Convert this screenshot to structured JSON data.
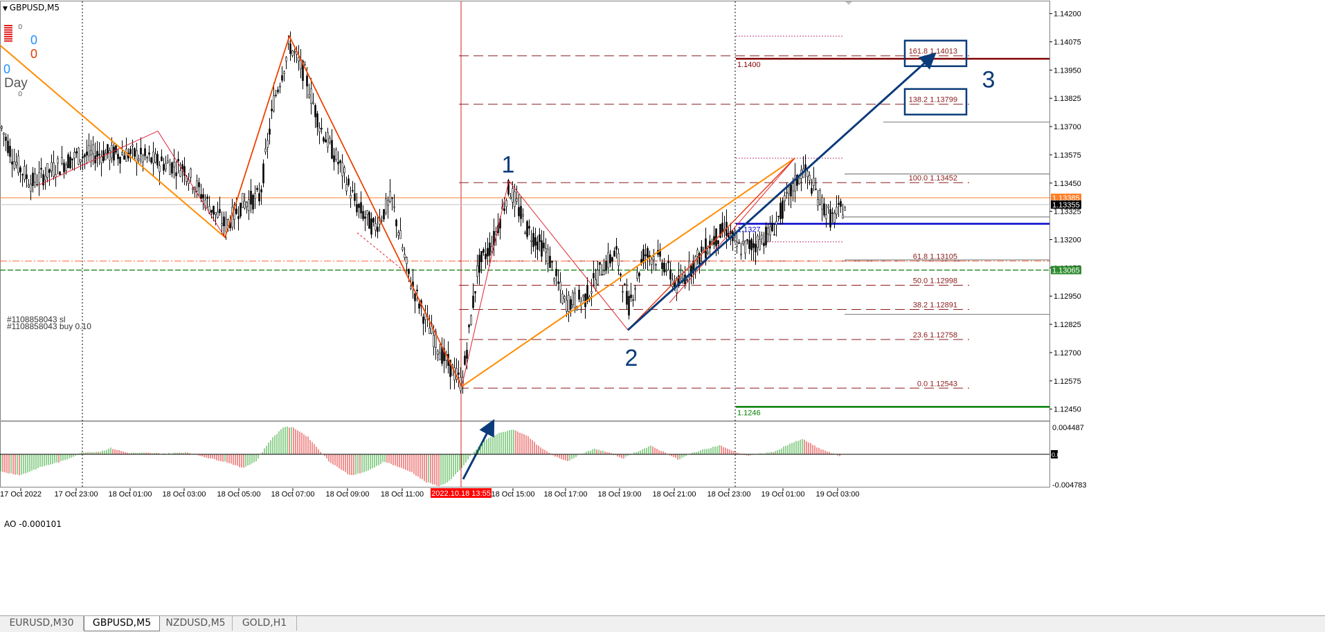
{
  "window": {
    "title": "GBPUSD,M5"
  },
  "indicator_panel": {
    "buy_count": "0",
    "sell_count": "0",
    "day_count": "0",
    "day_label": "Day",
    "bar_top_value": "0",
    "day_sub_value": "0"
  },
  "orders": {
    "sl_label": "#1108858043 sl",
    "buy_label": "#1108858043 buy 0.10"
  },
  "tabs": [
    {
      "label": "EURUSD,M30",
      "active": false
    },
    {
      "label": "GBPUSD,M5",
      "active": true
    },
    {
      "label": "NZDUSD,M5",
      "active": false
    },
    {
      "label": "GOLD,H1",
      "active": false
    }
  ],
  "colors": {
    "bull_ao": "#26a326",
    "bear_ao": "#e02020",
    "zigzag": "#ff8c00",
    "fib": "#8b1a1a",
    "wave_arrow": "#0b3b7a",
    "blue_level": "#0000cc",
    "green_level": "#008000",
    "dark_red_level": "#800000"
  },
  "chart_data": [
    {
      "type": "candlestick",
      "symbol": "GBPUSD",
      "timeframe": "M5",
      "ylim": [
        1.124,
        1.1426
      ],
      "y_ticks": [
        "1.14200",
        "1.14075",
        "1.13950",
        "1.13825",
        "1.13700",
        "1.13575",
        "1.13450",
        "1.13325",
        "1.13200",
        "1.13075",
        "1.12950",
        "1.12825",
        "1.12700",
        "1.12575",
        "1.12450"
      ],
      "x_ticks": [
        "17 Oct 2022",
        "17 Oct 23:00",
        "18 Oct 01:00",
        "18 Oct 03:00",
        "18 Oct 05:00",
        "18 Oct 07:00",
        "18 Oct 09:00",
        "18 Oct 11:00",
        "2022.10.18 13:55",
        "18 Oct 15:00",
        "18 Oct 17:00",
        "18 Oct 19:00",
        "18 Oct 21:00",
        "18 Oct 23:00",
        "19 Oct 01:00",
        "19 Oct 03:00"
      ],
      "price_path": [
        [
          0,
          1.1371
        ],
        [
          20,
          1.1355
        ],
        [
          45,
          1.1345
        ],
        [
          75,
          1.1351
        ],
        [
          110,
          1.1357
        ],
        [
          150,
          1.1358
        ],
        [
          190,
          1.1358
        ],
        [
          230,
          1.1354
        ],
        [
          265,
          1.1352
        ],
        [
          295,
          1.1338
        ],
        [
          325,
          1.1326
        ],
        [
          350,
          1.1336
        ],
        [
          375,
          1.1339
        ],
        [
          395,
          1.1381
        ],
        [
          418,
          1.1406
        ],
        [
          440,
          1.1393
        ],
        [
          462,
          1.137
        ],
        [
          490,
          1.1353
        ],
        [
          515,
          1.1335
        ],
        [
          540,
          1.1325
        ],
        [
          565,
          1.1338
        ],
        [
          590,
          1.1304
        ],
        [
          615,
          1.1284
        ],
        [
          640,
          1.1268
        ],
        [
          667,
          1.1256
        ],
        [
          690,
          1.1308
        ],
        [
          712,
          1.1319
        ],
        [
          735,
          1.1343
        ],
        [
          760,
          1.1325
        ],
        [
          790,
          1.1314
        ],
        [
          815,
          1.1292
        ],
        [
          845,
          1.1294
        ],
        [
          870,
          1.1308
        ],
        [
          890,
          1.1314
        ],
        [
          907,
          1.129
        ],
        [
          930,
          1.1314
        ],
        [
          955,
          1.1311
        ],
        [
          978,
          1.1299
        ],
        [
          1000,
          1.1309
        ],
        [
          1030,
          1.132
        ],
        [
          1050,
          1.1325
        ],
        [
          1065,
          1.1316
        ],
        [
          1090,
          1.1318
        ],
        [
          1115,
          1.1324
        ],
        [
          1140,
          1.134
        ],
        [
          1160,
          1.1351
        ],
        [
          1180,
          1.134
        ],
        [
          1200,
          1.1329
        ],
        [
          1222,
          1.1335
        ]
      ],
      "zigzag_orange": [
        {
          "time": "",
          "price": 1.1406
        },
        {
          "time": "",
          "price": 1.1321
        },
        {
          "time": "",
          "price": 1.141
        },
        {
          "time": "2022.10.18 13:55",
          "price": 1.1255
        },
        {
          "time": "",
          "price": 1.1356
        }
      ],
      "zigzag_orange_x": [
        0,
        325,
        418,
        667,
        1148
      ],
      "zigzag_red_x": [
        55,
        228,
        325,
        418,
        667,
        735,
        907,
        1148
      ],
      "zigzag_red_y": [
        1.1344,
        1.1368,
        1.1321,
        1.141,
        1.1255,
        1.1346,
        1.128,
        1.1356
      ],
      "fibonacci": [
        {
          "label": "161.8  1.14013",
          "price": 1.14013
        },
        {
          "label": "138.2  1.13799",
          "price": 1.13799
        },
        {
          "label": "100.0  1.13452",
          "price": 1.13452
        },
        {
          "label": "61.8  1.13105",
          "price": 1.13105
        },
        {
          "label": "50.0  1.12998",
          "price": 1.12998
        },
        {
          "label": "38.2  1.12891",
          "price": 1.12891
        },
        {
          "label": "23.6  1.12758",
          "price": 1.12758
        },
        {
          "label": "0.0  1.12543",
          "price": 1.12543
        }
      ],
      "horizontal_levels": [
        {
          "label": "1.1400",
          "price": 1.14,
          "kind": "dark_red"
        },
        {
          "label": "1.1327",
          "price": 1.1327,
          "kind": "blue"
        },
        {
          "label": "1.1246",
          "price": 1.1246,
          "kind": "green"
        }
      ],
      "price_tags": [
        {
          "label": "1.13385",
          "price": 1.13385,
          "kind": "ask"
        },
        {
          "label": "1.13355",
          "price": 1.13355,
          "kind": "bid"
        },
        {
          "label": "1.13065",
          "price": 1.13065,
          "kind": "order"
        }
      ],
      "order_lines": [
        {
          "price": 1.13105,
          "kind": "sl"
        },
        {
          "price": 1.13065,
          "kind": "buy"
        }
      ],
      "wave_labels": [
        "1",
        "2",
        "3"
      ],
      "wave_points": [
        {
          "label": "1",
          "price": 1.1346
        },
        {
          "label": "2",
          "price": 1.128
        },
        {
          "label": "3",
          "price": 1.1401
        }
      ]
    },
    {
      "type": "bar",
      "title": "AO -0.000101",
      "ylim": [
        -0.004783,
        0.004487
      ],
      "y_ticks": [
        "0.004487",
        "0.00",
        "-0.004783"
      ],
      "segments": [
        [
          0,
          -0.0025
        ],
        [
          30,
          -0.003
        ],
        [
          60,
          -0.0018
        ],
        [
          90,
          -0.001
        ],
        [
          120,
          0.0003
        ],
        [
          145,
          0.0004
        ],
        [
          160,
          0.0009
        ],
        [
          185,
          0.0002
        ],
        [
          210,
          0.0002
        ],
        [
          240,
          0.0001
        ],
        [
          270,
          0.0003
        ],
        [
          300,
          -0.0005
        ],
        [
          330,
          -0.0012
        ],
        [
          350,
          -0.002
        ],
        [
          370,
          -0.001
        ],
        [
          390,
          0.002
        ],
        [
          410,
          0.004
        ],
        [
          425,
          0.0038
        ],
        [
          445,
          0.0025
        ],
        [
          462,
          0.0005
        ],
        [
          475,
          -0.001
        ],
        [
          490,
          -0.002
        ],
        [
          505,
          -0.003
        ],
        [
          520,
          -0.0028
        ],
        [
          540,
          -0.002
        ],
        [
          555,
          -0.001
        ],
        [
          575,
          -0.0018
        ],
        [
          595,
          -0.0026
        ],
        [
          615,
          -0.004
        ],
        [
          635,
          -0.0046
        ],
        [
          650,
          -0.0038
        ],
        [
          667,
          -0.002
        ],
        [
          680,
          -0.0002
        ],
        [
          700,
          0.002
        ],
        [
          720,
          0.003
        ],
        [
          740,
          0.0036
        ],
        [
          760,
          0.0028
        ],
        [
          780,
          0.001
        ],
        [
          800,
          -0.0002
        ],
        [
          820,
          -0.001
        ],
        [
          840,
          0.0001
        ],
        [
          860,
          0.0008
        ],
        [
          880,
          0.0002
        ],
        [
          900,
          -0.0006
        ],
        [
          920,
          0.0004
        ],
        [
          940,
          0.0012
        ],
        [
          960,
          0.0003
        ],
        [
          980,
          -0.0008
        ],
        [
          1000,
          0.0002
        ],
        [
          1020,
          0.0008
        ],
        [
          1040,
          0.0013
        ],
        [
          1060,
          0.0004
        ],
        [
          1080,
          -0.0002
        ],
        [
          1100,
          0.0001
        ],
        [
          1120,
          0.0004
        ],
        [
          1140,
          0.0015
        ],
        [
          1160,
          0.0022
        ],
        [
          1180,
          0.001
        ],
        [
          1200,
          0.0002
        ],
        [
          1215,
          -0.0003
        ]
      ]
    }
  ]
}
